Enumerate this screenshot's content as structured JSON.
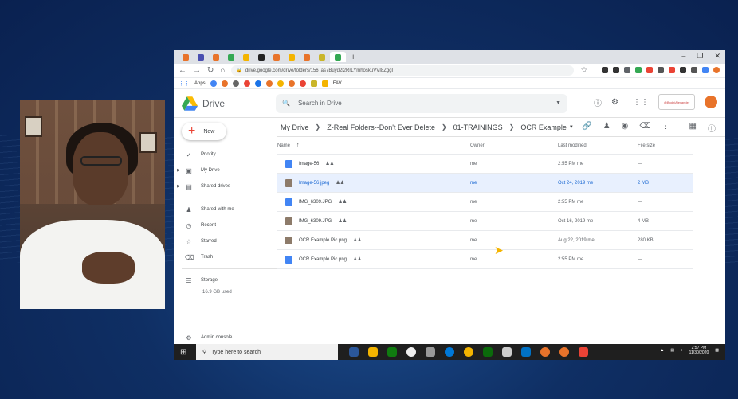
{
  "browser": {
    "url": "drive.google.com/drive/folders/156Tas7Buyd2l2RrLYmhoskuVVI8Zggl",
    "new_tab": "+",
    "bookmarks": {
      "apps_label": "Apps",
      "fav_label": "FAV"
    }
  },
  "drive": {
    "logo_text": "Drive",
    "search_placeholder": "Search in Drive",
    "brand_badge": "@BodhiAlexander",
    "new_button": "New",
    "sidebar": [
      {
        "label": "Priority",
        "icon": "check-circle-icon"
      },
      {
        "label": "My Drive",
        "icon": "drive-icon"
      },
      {
        "label": "Shared drives",
        "icon": "shared-drives-icon"
      },
      {
        "label": "Shared with me",
        "icon": "people-icon"
      },
      {
        "label": "Recent",
        "icon": "clock-icon"
      },
      {
        "label": "Starred",
        "icon": "star-icon"
      },
      {
        "label": "Trash",
        "icon": "trash-icon"
      },
      {
        "label": "Storage",
        "icon": "storage-icon"
      }
    ],
    "storage_used": "16.9 GB used",
    "admin_console": "Admin console",
    "breadcrumb": [
      "My Drive",
      "Z-Real Folders--Don't Ever Delete",
      "01-TRAININGS",
      "OCR Example"
    ],
    "columns": {
      "name": "Name",
      "owner": "Owner",
      "modified": "Last modified",
      "size": "File size"
    },
    "files": [
      {
        "name": "Image-56",
        "owner": "me",
        "modified": "2:55 PM  me",
        "size": "—",
        "type": "doc",
        "selected": false
      },
      {
        "name": "Image-56.jpeg",
        "owner": "me",
        "modified": "Oct 24, 2019  me",
        "size": "2 MB",
        "type": "img",
        "selected": true
      },
      {
        "name": "IMG_6309.JPG",
        "owner": "me",
        "modified": "2:55 PM  me",
        "size": "—",
        "type": "doc",
        "selected": false
      },
      {
        "name": "IMG_6309.JPG",
        "owner": "me",
        "modified": "Oct 16, 2019  me",
        "size": "4 MB",
        "type": "img",
        "selected": false
      },
      {
        "name": "OCR Example Pic.png",
        "owner": "me",
        "modified": "Aug 22, 2019  me",
        "size": "280 KB",
        "type": "img",
        "selected": false
      },
      {
        "name": "OCR Example Pic.png",
        "owner": "me",
        "modified": "2:55 PM  me",
        "size": "—",
        "type": "doc",
        "selected": false
      }
    ]
  },
  "taskbar": {
    "search_placeholder": "Type here to search",
    "time": "2:57 PM",
    "date": "11/30/2020"
  }
}
